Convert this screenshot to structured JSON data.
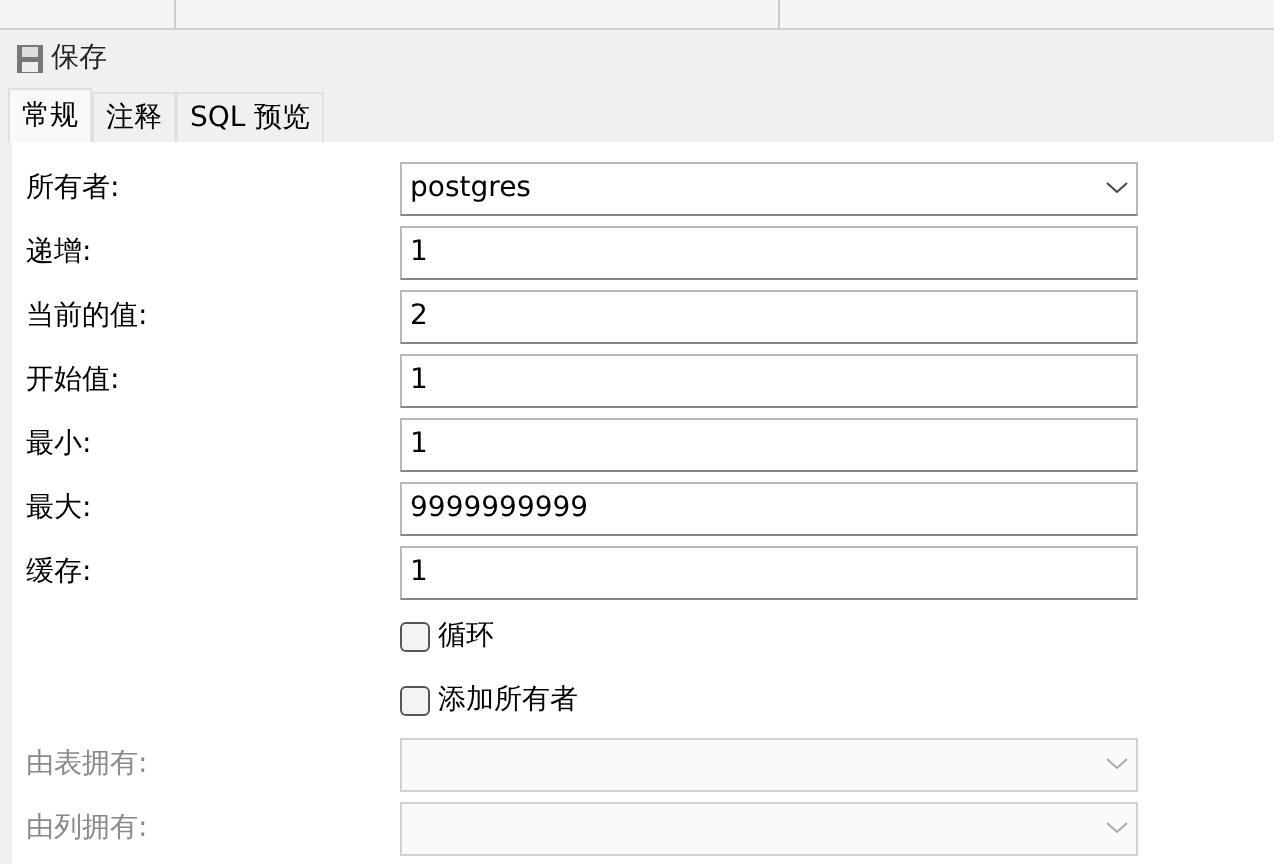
{
  "toolbar": {
    "save_label": "保存"
  },
  "tabs": [
    {
      "label": "常规",
      "selected": true
    },
    {
      "label": "注释",
      "selected": false
    },
    {
      "label": "SQL 预览",
      "selected": false
    }
  ],
  "fields": [
    {
      "kind": "select",
      "label": "所有者:",
      "value": "postgres",
      "disabled": false
    },
    {
      "kind": "text",
      "label": "递增:",
      "value": "1",
      "disabled": false
    },
    {
      "kind": "text",
      "label": "当前的值:",
      "value": "2",
      "disabled": false
    },
    {
      "kind": "text",
      "label": "开始值:",
      "value": "1",
      "disabled": false
    },
    {
      "kind": "text",
      "label": "最小:",
      "value": "1",
      "disabled": false
    },
    {
      "kind": "text",
      "label": "最大:",
      "value": "9999999999",
      "disabled": false
    },
    {
      "kind": "text",
      "label": "缓存:",
      "value": "1",
      "disabled": false
    },
    {
      "kind": "checkbox",
      "label": "循环",
      "checked": false
    },
    {
      "kind": "checkbox",
      "label": "添加所有者",
      "checked": false
    },
    {
      "kind": "select",
      "label": "由表拥有:",
      "disabled": true
    },
    {
      "kind": "select",
      "label": "由列拥有:",
      "disabled": true
    }
  ]
}
